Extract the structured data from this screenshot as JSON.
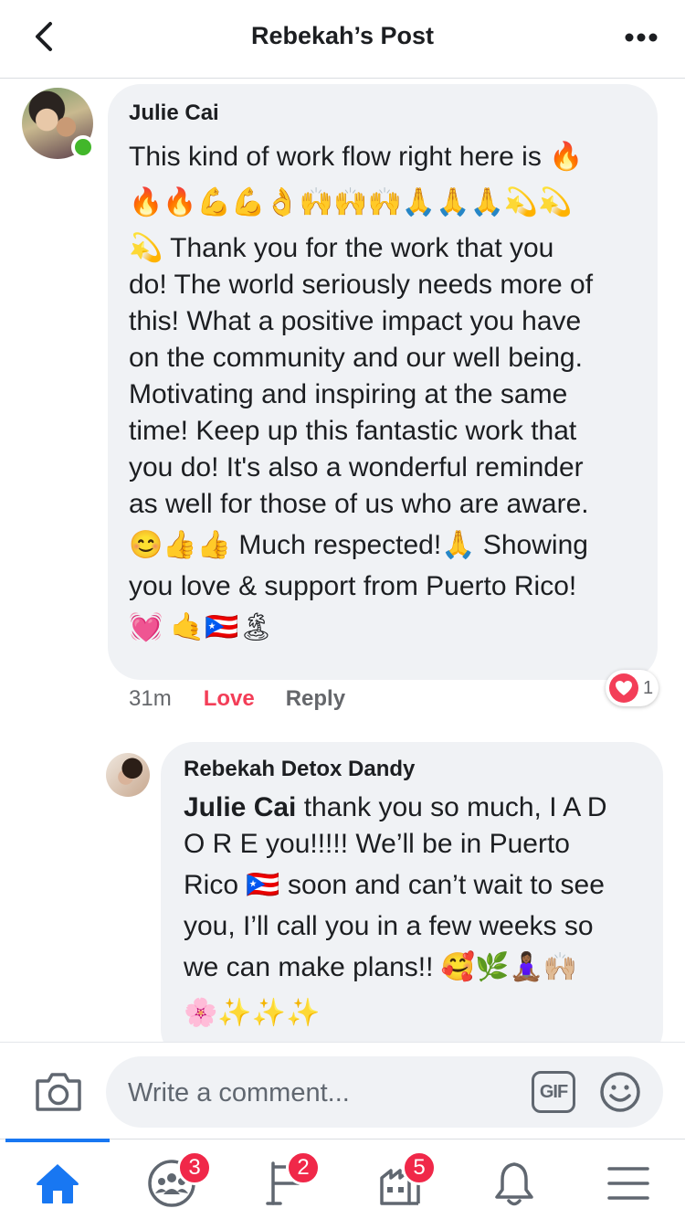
{
  "header": {
    "title": "Rebekah’s Post"
  },
  "comment": {
    "author": "Julie Cai",
    "text_lines": [
      "This kind of work flow right here is 🔥",
      "🔥🔥💪💪👌🙌🙌🙌🙏🙏🙏💫💫",
      "💫 Thank you for the work that you",
      "do! The world seriously needs more of",
      "this! What a positive impact you have",
      "on the community and our well being.",
      "Motivating and inspiring at the same",
      "time! Keep up this fantastic work that",
      "you do! It's also a wonderful reminder",
      "as well for those of us who are aware.",
      "😊👍👍 Much respected!🙏 Showing",
      "you love & support from Puerto Rico!",
      "💓 🤙🇵🇷🏝"
    ],
    "time": "31m",
    "love_label": "Love",
    "reply_label": "Reply",
    "reaction_count": "1"
  },
  "reply": {
    "author": "Rebekah Detox Dandy",
    "mention": "Julie Cai",
    "text_lines": [
      " thank you so much, I A D",
      "O R E you!!!!! We’ll be in Puerto",
      "Rico 🇵🇷 soon and can’t wait to see",
      "you, I’ll call you in a few weeks so",
      "we can make plans!! 🥰🌿🧘🏾‍♀️🙌🏼",
      "🌸✨✨✨"
    ]
  },
  "composer": {
    "placeholder": "Write a comment...",
    "gif_label": "GIF"
  },
  "nav": {
    "groups_badge": "3",
    "pages_badge": "2",
    "marketplace_badge": "5"
  },
  "colors": {
    "accent": "#1877f2",
    "love": "#f33e58",
    "badge": "#f02849",
    "bubble": "#f0f2f5",
    "online": "#42b72a"
  }
}
